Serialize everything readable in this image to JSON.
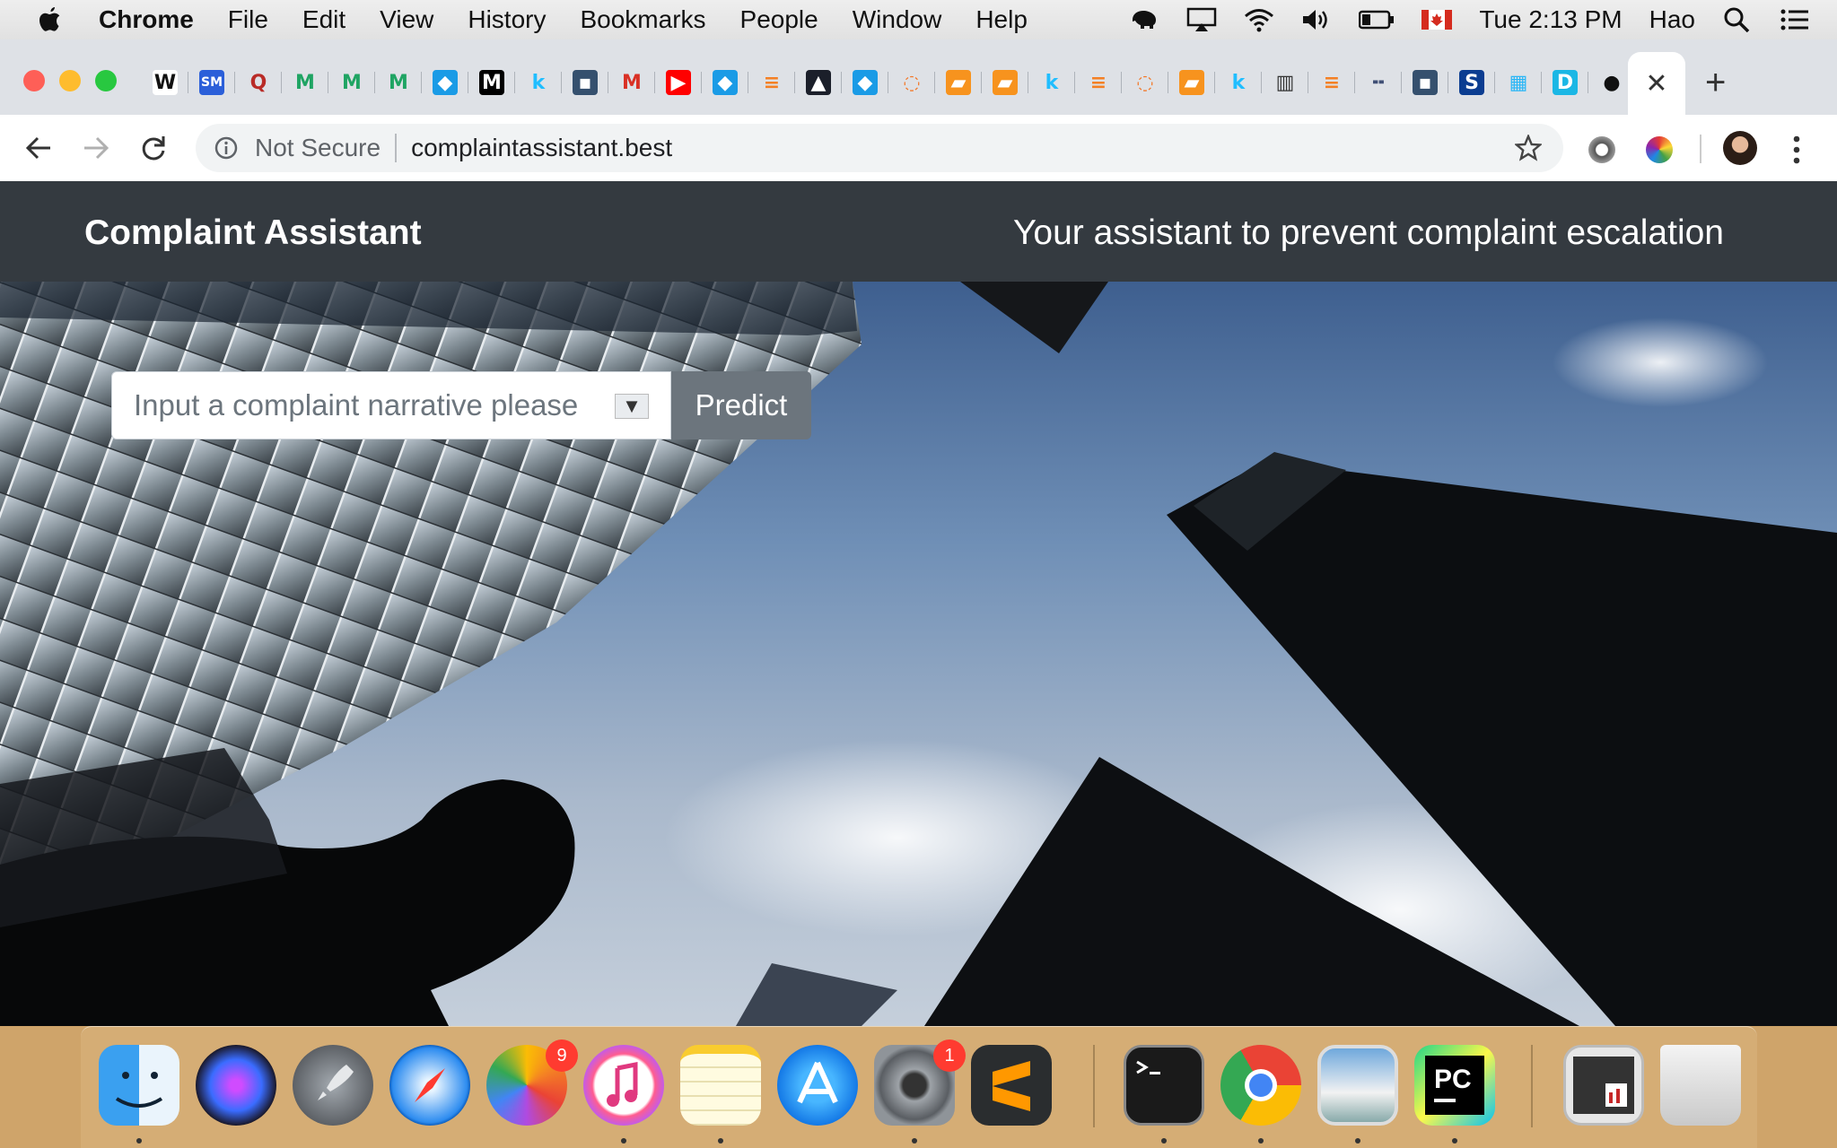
{
  "menubar": {
    "app_name": "Chrome",
    "items": [
      "File",
      "Edit",
      "View",
      "History",
      "Bookmarks",
      "People",
      "Window",
      "Help"
    ],
    "clock": "Tue 2:13 PM",
    "user": "Hao"
  },
  "browser": {
    "active_tab_close": "✕",
    "new_tab": "+",
    "security_label": "Not Secure",
    "url": "complaintassistant.best",
    "favicons": [
      {
        "name": "wikipedia-favicon",
        "glyph": "W",
        "bg": "#ffffff",
        "fg": "#111111"
      },
      {
        "name": "sm-favicon",
        "glyph": "SM",
        "bg": "#2b5fd9",
        "fg": "#ffffff"
      },
      {
        "name": "quora-favicon",
        "glyph": "Q",
        "bg": "#dee1e6",
        "fg": "#b92b27"
      },
      {
        "name": "gmail-favicon",
        "glyph": "M",
        "bg": "#dee1e6",
        "fg": "#1fa463"
      },
      {
        "name": "gmail-favicon",
        "glyph": "M",
        "bg": "#dee1e6",
        "fg": "#1fa463"
      },
      {
        "name": "gmail-favicon",
        "glyph": "M",
        "bg": "#dee1e6",
        "fg": "#1fa463"
      },
      {
        "name": "shield-favicon",
        "glyph": "◆",
        "bg": "#1a9be6",
        "fg": "#ffffff"
      },
      {
        "name": "medium-favicon",
        "glyph": "M",
        "bg": "#000000",
        "fg": "#ffffff"
      },
      {
        "name": "kaggle-favicon",
        "glyph": "k",
        "bg": "#dee1e6",
        "fg": "#20beff"
      },
      {
        "name": "tds-favicon",
        "glyph": "▪",
        "bg": "#35506e",
        "fg": "#ffffff"
      },
      {
        "name": "gmail-favicon",
        "glyph": "M",
        "bg": "#dee1e6",
        "fg": "#d93025"
      },
      {
        "name": "youtube-favicon",
        "glyph": "▶",
        "bg": "#ff0000",
        "fg": "#ffffff"
      },
      {
        "name": "shield-favicon",
        "glyph": "◆",
        "bg": "#1a9be6",
        "fg": "#ffffff"
      },
      {
        "name": "stackoverflow-favicon",
        "glyph": "≡",
        "bg": "#dee1e6",
        "fg": "#f48024"
      },
      {
        "name": "rocket-favicon",
        "glyph": "▲",
        "bg": "#1b1f2a",
        "fg": "#ffffff"
      },
      {
        "name": "shield-favicon",
        "glyph": "◆",
        "bg": "#1a9be6",
        "fg": "#ffffff"
      },
      {
        "name": "jupyter-favicon",
        "glyph": "◌",
        "bg": "#dee1e6",
        "fg": "#f37726"
      },
      {
        "name": "book-favicon",
        "glyph": "▰",
        "bg": "#f7931e",
        "fg": "#ffffff"
      },
      {
        "name": "book-favicon",
        "glyph": "▰",
        "bg": "#f7931e",
        "fg": "#ffffff"
      },
      {
        "name": "kaggle-favicon",
        "glyph": "k",
        "bg": "#dee1e6",
        "fg": "#20beff"
      },
      {
        "name": "stackoverflow-favicon",
        "glyph": "≡",
        "bg": "#dee1e6",
        "fg": "#f48024"
      },
      {
        "name": "jupyter-favicon",
        "glyph": "◌",
        "bg": "#dee1e6",
        "fg": "#f37726"
      },
      {
        "name": "book-favicon",
        "glyph": "▰",
        "bg": "#f7931e",
        "fg": "#ffffff"
      },
      {
        "name": "kaggle-favicon",
        "glyph": "k",
        "bg": "#dee1e6",
        "fg": "#20beff"
      },
      {
        "name": "reader-favicon",
        "glyph": "▥",
        "bg": "#dee1e6",
        "fg": "#333333"
      },
      {
        "name": "stackoverflow-favicon",
        "glyph": "≡",
        "bg": "#dee1e6",
        "fg": "#f48024"
      },
      {
        "name": "plotly-favicon",
        "glyph": "╍",
        "bg": "#dee1e6",
        "fg": "#3f4f75"
      },
      {
        "name": "tds-favicon",
        "glyph": "▪",
        "bg": "#35506e",
        "fg": "#ffffff"
      },
      {
        "name": "s-favicon",
        "glyph": "S",
        "bg": "#0b3d91",
        "fg": "#ffffff"
      },
      {
        "name": "grid-favicon",
        "glyph": "▦",
        "bg": "#dee1e6",
        "fg": "#29b6f6"
      },
      {
        "name": "d-favicon",
        "glyph": "D",
        "bg": "#1bb7e5",
        "fg": "#ffffff"
      },
      {
        "name": "github-favicon",
        "glyph": "●",
        "bg": "#dee1e6",
        "fg": "#111111"
      }
    ]
  },
  "site": {
    "brand": "Complaint Assistant",
    "tagline": "Your assistant to prevent complaint escalation",
    "select_placeholder": "Input a complaint narrative please",
    "select_arrow": "▼",
    "predict_label": "Predict"
  },
  "dock": {
    "items": [
      {
        "name": "finder-dock-icon",
        "running": true
      },
      {
        "name": "siri-dock-icon",
        "running": false
      },
      {
        "name": "launchpad-dock-icon",
        "running": false
      },
      {
        "name": "safari-dock-icon",
        "running": false
      },
      {
        "name": "photos-dock-icon",
        "running": false,
        "badge": "9"
      },
      {
        "name": "itunes-dock-icon",
        "running": true
      },
      {
        "name": "notes-dock-icon",
        "running": true
      },
      {
        "name": "app-store-dock-icon",
        "running": false
      },
      {
        "name": "system-preferences-dock-icon",
        "running": true,
        "badge": "1"
      },
      {
        "name": "sublime-text-dock-icon",
        "running": false
      },
      {
        "name": "terminal-dock-icon",
        "running": true
      },
      {
        "name": "chrome-dock-icon",
        "running": true
      },
      {
        "name": "preview-dock-icon",
        "running": true
      },
      {
        "name": "pycharm-dock-icon",
        "running": true
      },
      {
        "name": "document-dock-icon",
        "running": false
      },
      {
        "name": "trash-dock-icon",
        "running": false
      }
    ],
    "badges": {
      "photos": "9",
      "system_preferences": "1"
    }
  }
}
